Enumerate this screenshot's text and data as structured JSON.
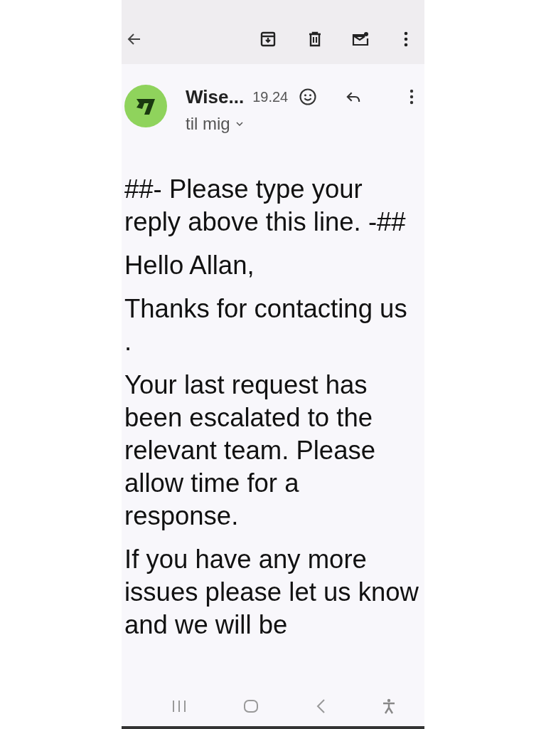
{
  "message": {
    "sender": "Wise...",
    "time": "19.24",
    "recipient": "til mig",
    "body": [
      "##- Please type your reply above this line. -##",
      "Hello Allan,",
      "Thanks for contacting us .",
      "Your last request has been escalated to the relevant team. Please allow time for a response.",
      "If you have any more issues please let us know and we will be"
    ]
  }
}
